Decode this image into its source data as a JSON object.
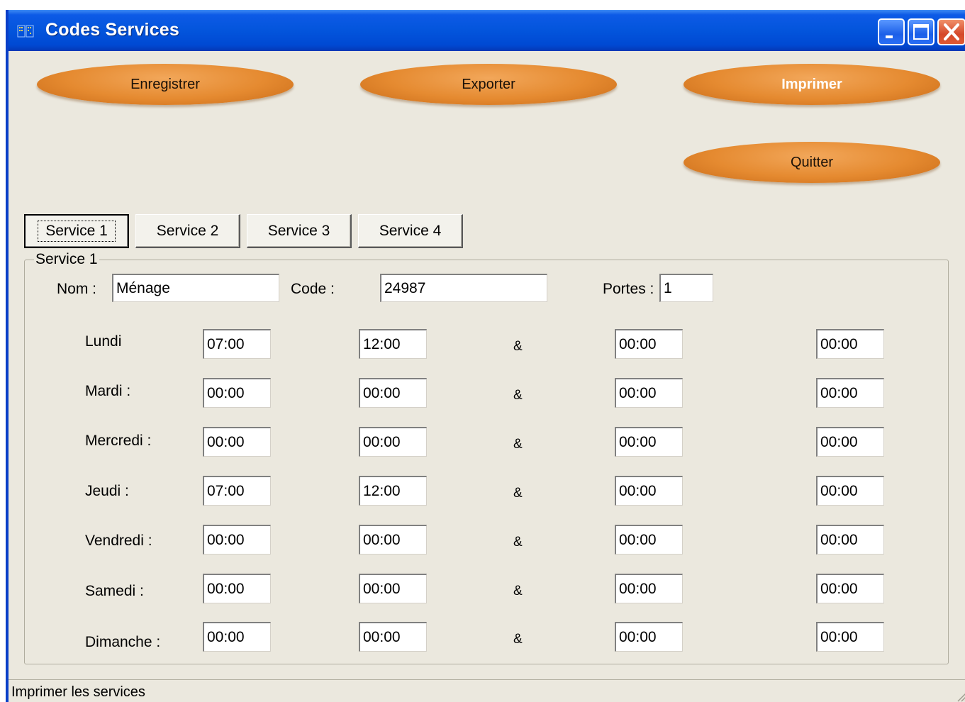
{
  "window": {
    "title": "Codes Services"
  },
  "toolbar": {
    "save_label": "Enregistrer",
    "export_label": "Exporter",
    "print_label": "Imprimer",
    "quit_label": "Quitter"
  },
  "tabs": [
    {
      "label": "Service 1",
      "active": true
    },
    {
      "label": "Service 2",
      "active": false
    },
    {
      "label": "Service 3",
      "active": false
    },
    {
      "label": "Service 4",
      "active": false
    }
  ],
  "group": {
    "legend": "Service 1",
    "name_label": "Nom :",
    "name_value": "Ménage",
    "code_label": "Code :",
    "code_value": "24987",
    "doors_label": "Portes :",
    "doors_value": "1",
    "separator": "&"
  },
  "schedule": [
    {
      "day": "Lundi",
      "times": [
        "07:00",
        "12:00",
        "00:00",
        "00:00"
      ]
    },
    {
      "day": "Mardi :",
      "times": [
        "00:00",
        "00:00",
        "00:00",
        "00:00"
      ]
    },
    {
      "day": "Mercredi :",
      "times": [
        "00:00",
        "00:00",
        "00:00",
        "00:00"
      ]
    },
    {
      "day": "Jeudi :",
      "times": [
        "07:00",
        "12:00",
        "00:00",
        "00:00"
      ]
    },
    {
      "day": "Vendredi :",
      "times": [
        "00:00",
        "00:00",
        "00:00",
        "00:00"
      ]
    },
    {
      "day": "Samedi :",
      "times": [
        "00:00",
        "00:00",
        "00:00",
        "00:00"
      ]
    },
    {
      "day": "Dimanche :",
      "times": [
        "00:00",
        "00:00",
        "00:00",
        "00:00"
      ]
    }
  ],
  "status": {
    "text": "Imprimer les services"
  }
}
